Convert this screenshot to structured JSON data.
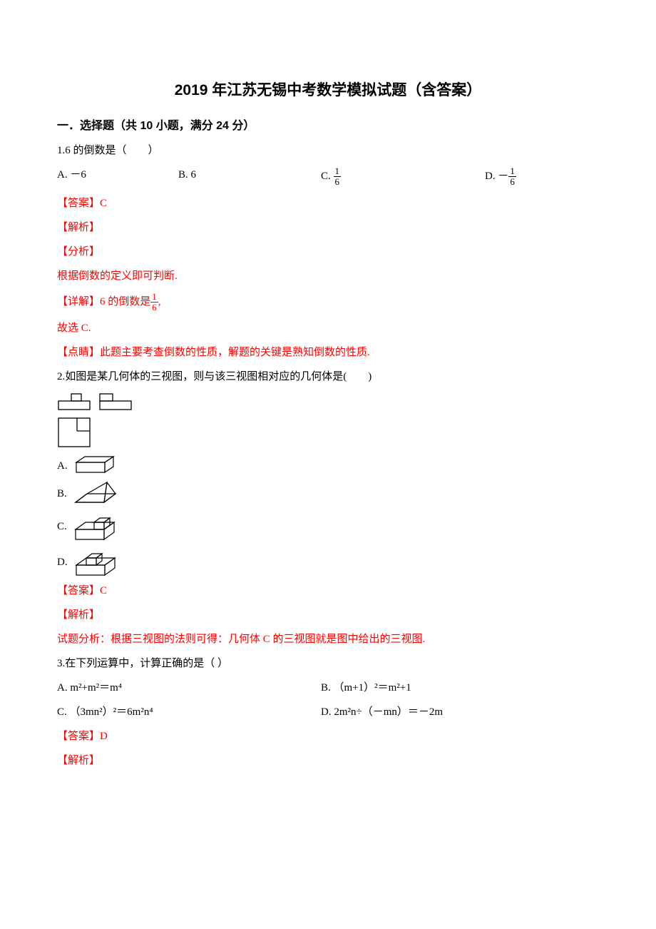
{
  "title": "2019 年江苏无锡中考数学模拟试题（含答案）",
  "section1": {
    "header": "一．选择题（共 10 小题，满分 24 分）",
    "q1": {
      "stem": "1.6 的倒数是（　　）",
      "A": "A. －6",
      "B": "B. 6",
      "C_prefix": "C. ",
      "D_prefix": "D. －",
      "frac_num": "1",
      "frac_den": "6",
      "answer": "【答案】C",
      "jiexi": "【解析】",
      "fenxi": "【分析】",
      "fenxi_text": "根据倒数的定义即可判断.",
      "detail_prefix": "【详解】6 的倒数是",
      "detail_suffix": ",",
      "conclude": "故选 C.",
      "dianjing": "【点睛】此题主要考查倒数的性质，解题的关键是熟知倒数的性质."
    },
    "q2": {
      "stem": "2.如图是某几何体的三视图，则与该三视图相对应的几何体是(　　)",
      "A": "A.",
      "B": "B.",
      "C": "C.",
      "D": "D.",
      "answer": "【答案】C",
      "jiexi": "【解析】",
      "analysis": "试题分析：根据三视图的法则可得：几何体 C 的三视图就是图中给出的三视图."
    },
    "q3": {
      "stem": "3.在下列运算中，计算正确的是（ ）",
      "A": "A. m²+m²＝m⁴",
      "B": "B. （m+1）²＝m²+1",
      "C": "C. （3mn²）²＝6m²n⁴",
      "D": "D. 2m²n÷（－mn）＝－2m",
      "answer": "【答案】D",
      "jiexi": "【解析】"
    }
  }
}
